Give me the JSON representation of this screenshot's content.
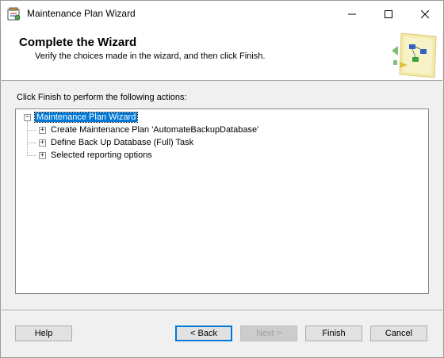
{
  "window": {
    "title": "Maintenance Plan Wizard",
    "icons": {
      "app": "wizard-app-icon",
      "minimize": "minimize-icon",
      "maximize": "maximize-icon",
      "close": "close-icon"
    }
  },
  "header": {
    "title": "Complete the Wizard",
    "subtitle": "Verify the choices made in the wizard, and then click Finish.",
    "image": "wizard-illustration-icon"
  },
  "instruction": "Click Finish to perform the following actions:",
  "tree": {
    "root": {
      "label": "Maintenance Plan Wizard",
      "expanded": true,
      "selected": true,
      "expander": "−"
    },
    "children": [
      {
        "label": "Create Maintenance Plan 'AutomateBackupDatabase'",
        "expander": "+"
      },
      {
        "label": "Define Back Up Database (Full) Task",
        "expander": "+"
      },
      {
        "label": "Selected reporting options",
        "expander": "+"
      }
    ]
  },
  "buttons": {
    "help": "Help",
    "back": "< Back",
    "next": "Next >",
    "finish": "Finish",
    "cancel": "Cancel"
  },
  "colors": {
    "selection": "#0078d7",
    "accent": "#0078d7"
  }
}
